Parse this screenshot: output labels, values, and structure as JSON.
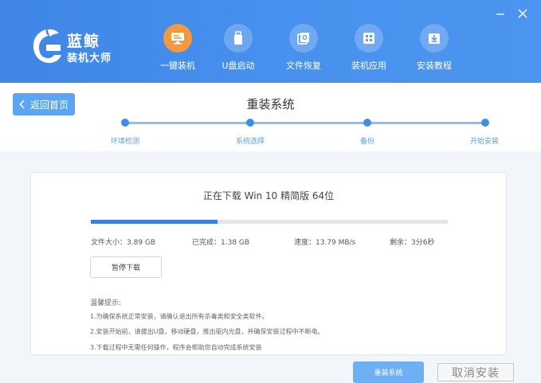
{
  "app": {
    "title_main": "蓝鲸",
    "title_sub": "装机大师",
    "logo_icon": "whale-logo-icon"
  },
  "nav": [
    {
      "label": "一键装机",
      "icon": "monitor-icon",
      "active": true
    },
    {
      "label": "U盘启动",
      "icon": "usb-icon",
      "active": false
    },
    {
      "label": "文件恢复",
      "icon": "file-restore-icon",
      "active": false
    },
    {
      "label": "装机应用",
      "icon": "apps-grid-icon",
      "active": false
    },
    {
      "label": "安装教程",
      "icon": "download-box-icon",
      "active": false
    }
  ],
  "window": {
    "minimize_icon": "minimize-icon",
    "close_icon": "close-icon"
  },
  "stepbar": {
    "back_label": "返回首页",
    "title": "重装系统",
    "steps": [
      "环境检测",
      "系统选择",
      "备份",
      "开始安装"
    ]
  },
  "download": {
    "title": "正在下载 Win 10 精简版 64位",
    "progress": 0.355,
    "file_size": "文件大小：3.89 GB",
    "completed": "已完成：1.38 GB",
    "speed": "速度：13.79 MB/s",
    "remaining": "剩余：3分6秒",
    "pause_label": "暂停下载"
  },
  "tips": {
    "title": "温馨提示:",
    "items": [
      "1.为确保系统正常安装，请确认退出所有杀毒类和安全类软件。",
      "2.安装开始前，请拔出U盘，移动硬盘，推出驱内光盘，并确保安装过程中不断电。",
      "3.下载过程中无需任何操作，程序会帮助您自动完成系统安装"
    ]
  },
  "footer": {
    "reinstall_label": "重装系统",
    "cancel_label": "取消安装"
  },
  "colors": {
    "header": "#4891ee",
    "accent": "#3a7fe0",
    "active_nav": "#f39a3e"
  }
}
